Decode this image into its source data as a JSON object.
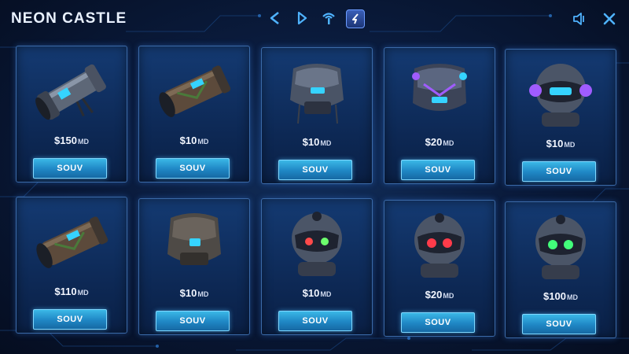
{
  "app": {
    "title": "NEON CASTLE"
  },
  "nav": {
    "buttons": [
      {
        "icon": "chevron-left-icon"
      },
      {
        "icon": "play-icon"
      },
      {
        "icon": "signal-tower-icon"
      },
      {
        "icon": "shield-badge-icon",
        "active": true
      }
    ]
  },
  "window_controls": [
    {
      "icon": "speaker-icon"
    },
    {
      "icon": "close-icon"
    }
  ],
  "accent_colors": {
    "button": "#2aa3dc",
    "card_border": "#3b6aa8",
    "background": "#0a1b3c"
  },
  "items": [
    {
      "name_icon": "arm-gauntlet-gray",
      "price": "$150",
      "currency": "MD",
      "button": "SOUV",
      "eye": "#35d3ff"
    },
    {
      "name_icon": "arm-gauntlet-rust",
      "price": "$10",
      "currency": "MD",
      "button": "SOUV",
      "eye": "#35d3ff"
    },
    {
      "name_icon": "chest-armor-cyan",
      "price": "$10",
      "currency": "MD",
      "button": "SOUV",
      "eye": "#35d3ff"
    },
    {
      "name_icon": "chest-armor-purple",
      "price": "$20",
      "currency": "MD",
      "button": "SOUV",
      "eye": "#a05cff"
    },
    {
      "name_icon": "robot-head-cyan",
      "price": "$10",
      "currency": "MD",
      "button": "SOUV",
      "eye": "#35d3ff"
    },
    {
      "name_icon": "arm-gauntlet-rust-2",
      "price": "$110",
      "currency": "MD",
      "button": "SOUV",
      "eye": "#35d3ff"
    },
    {
      "name_icon": "chest-armor-bronze",
      "price": "$10",
      "currency": "MD",
      "button": "SOUV",
      "eye": "#35d3ff"
    },
    {
      "name_icon": "robot-head-green",
      "price": "$10",
      "currency": "MD",
      "button": "SOUV",
      "eye": "#6dff6d"
    },
    {
      "name_icon": "robot-head-red",
      "price": "$20",
      "currency": "MD",
      "button": "SOUV",
      "eye": "#ff3b4a"
    },
    {
      "name_icon": "robot-head-green-2",
      "price": "$100",
      "currency": "MD",
      "button": "SOUV",
      "eye": "#42ff7a"
    }
  ]
}
